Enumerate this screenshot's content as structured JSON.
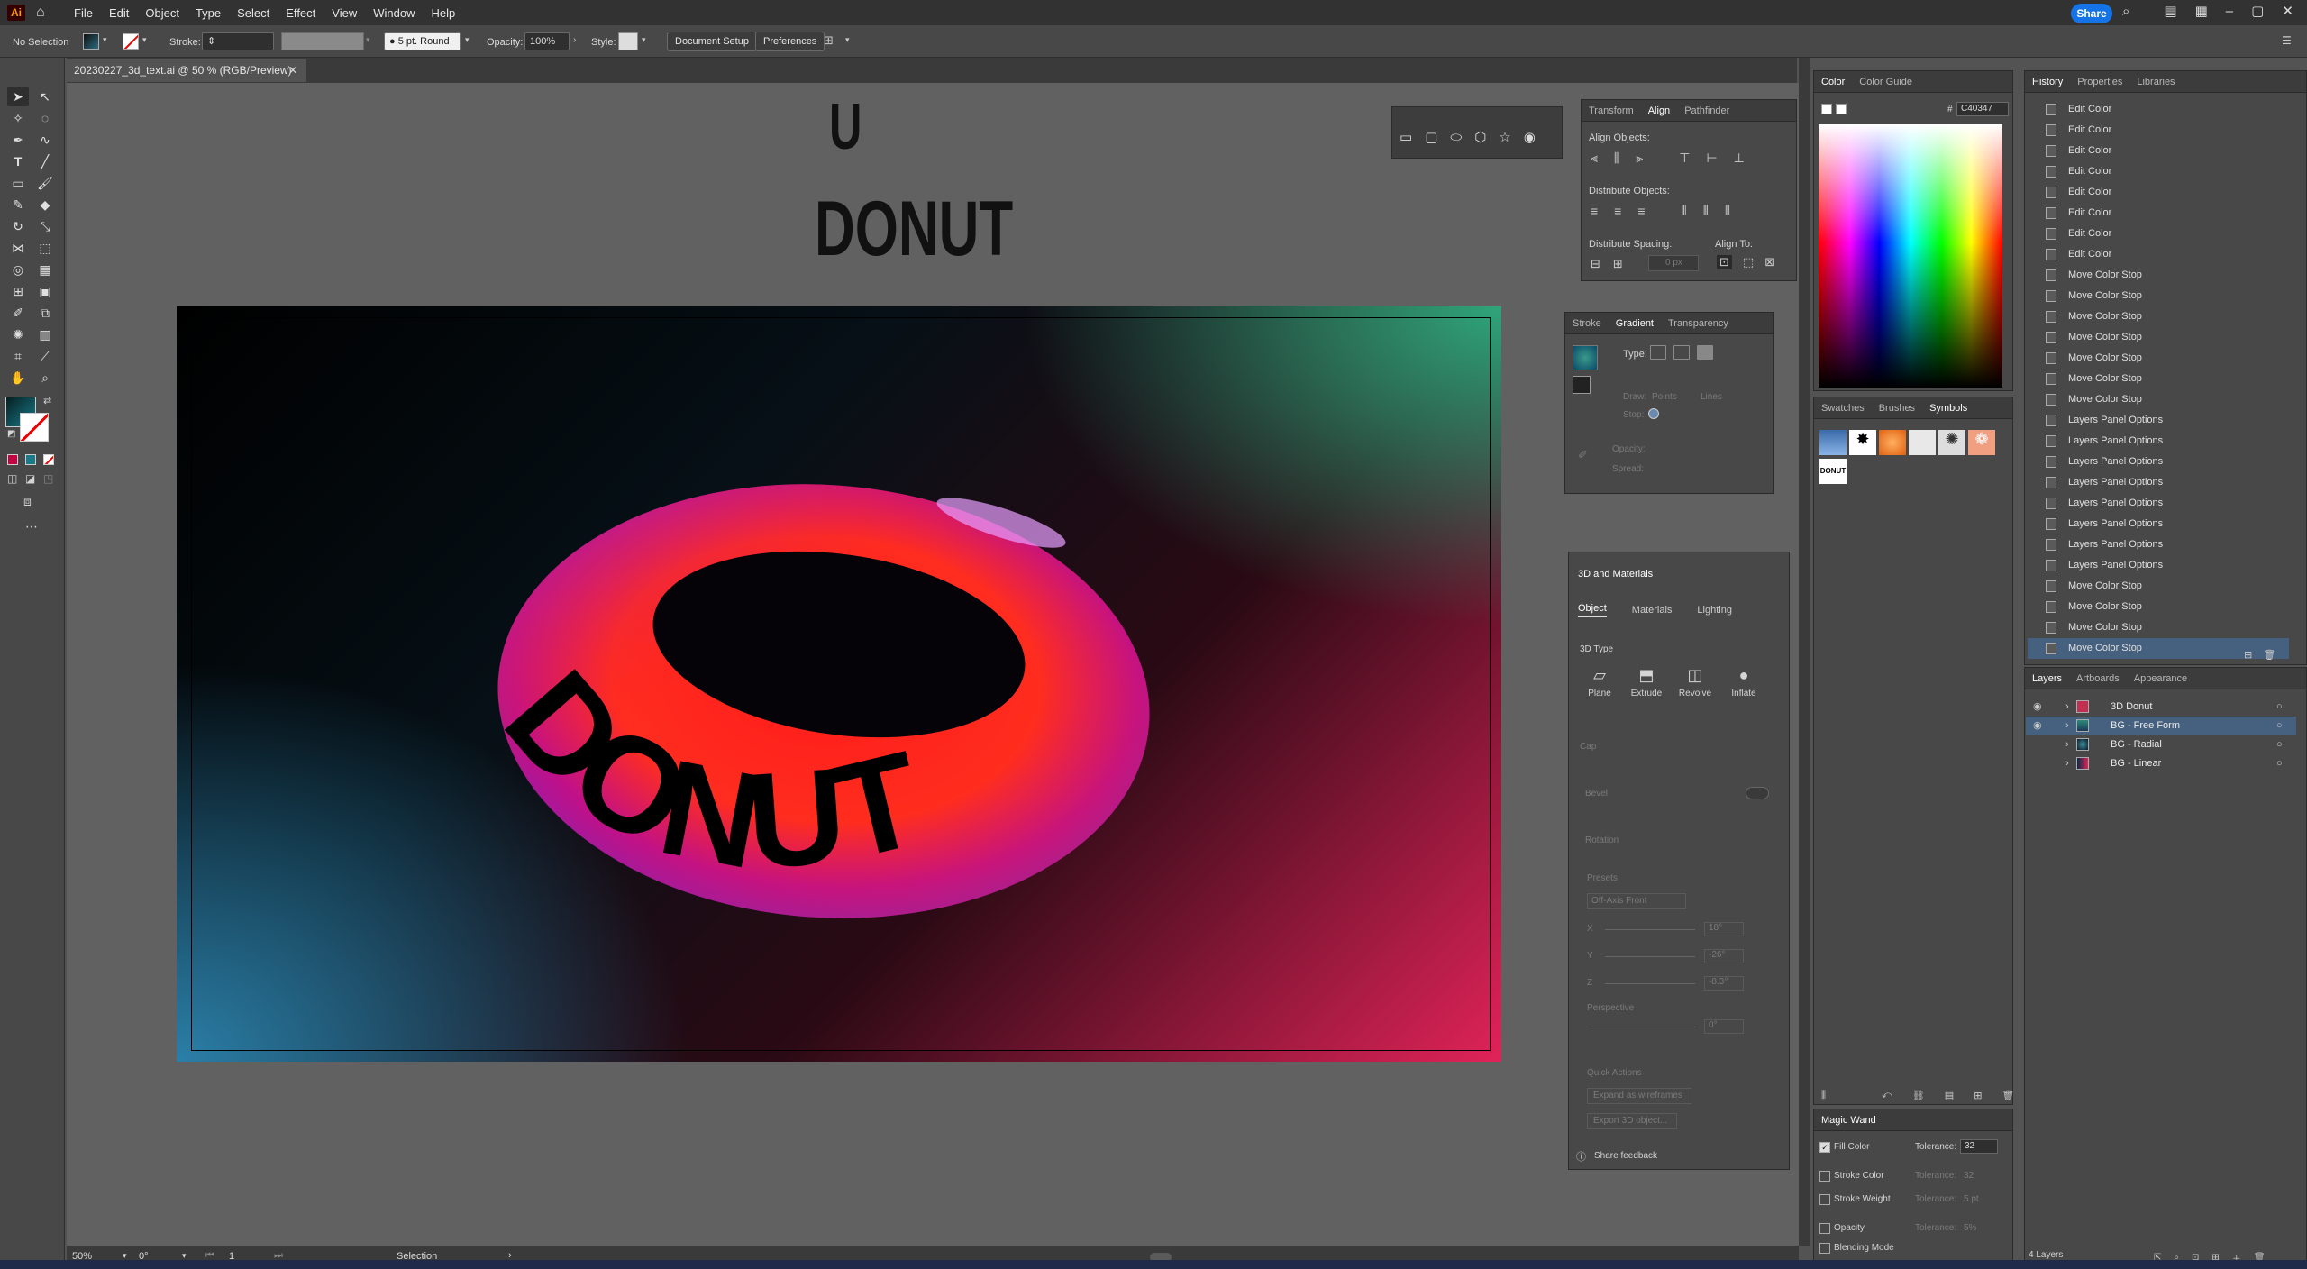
{
  "app": {
    "logo": "Ai",
    "share_label": "Share"
  },
  "menu": [
    "File",
    "Edit",
    "Object",
    "Type",
    "Select",
    "Effect",
    "View",
    "Window",
    "Help"
  ],
  "control": {
    "selection_status": "No Selection",
    "stroke_label": "Stroke:",
    "brush_label": "5 pt. Round",
    "opacity_label": "Opacity:",
    "opacity_value": "100%",
    "style_label": "Style:",
    "document_setup": "Document Setup",
    "preferences": "Preferences"
  },
  "document": {
    "tab_title": "20230227_3d_text.ai @ 50 % (RGB/Preview)"
  },
  "canvas": {
    "title_top": "U",
    "title_main": "DONUT",
    "donut_text": "DONUT"
  },
  "align_panel": {
    "tabs": [
      "Transform",
      "Align",
      "Pathfinder"
    ],
    "align_objects": "Align Objects:",
    "distribute_objects": "Distribute Objects:",
    "distribute_spacing": "Distribute Spacing:",
    "align_to": "Align To:",
    "spacing_value": "0 px"
  },
  "gradient_panel": {
    "tabs": [
      "Stroke",
      "Gradient",
      "Transparency"
    ],
    "type_label": "Type:",
    "draw_label": "Draw:",
    "draw_points": "Points",
    "draw_lines": "Lines",
    "stop_label": "Stop:",
    "opacity_label": "Opacity:",
    "spread_label": "Spread:"
  },
  "materials_panel": {
    "title": "3D and Materials",
    "tabs": [
      "Object",
      "Materials",
      "Lighting"
    ],
    "type_header": "3D Type",
    "types": [
      "Plane",
      "Extrude",
      "Revolve",
      "Inflate"
    ],
    "cap": "Cap",
    "bevel": "Bevel",
    "rotation": "Rotation",
    "presets": "Presets",
    "preset_value": "Off-Axis Front",
    "x_label": "X",
    "x_value": "18°",
    "y_label": "Y",
    "y_value": "-26°",
    "z_label": "Z",
    "z_value": "-8.3°",
    "perspective": "Perspective",
    "perspective_value": "0°",
    "quick_actions": "Quick Actions",
    "expand_wireframes": "Expand as wireframes",
    "export_3d": "Export 3D object...",
    "share_feedback": "Share feedback"
  },
  "color_panel": {
    "tabs": [
      "Color",
      "Color Guide"
    ],
    "hex_label": "#",
    "hex_value": "C40347"
  },
  "swatches_panel": {
    "tabs": [
      "Swatches",
      "Brushes",
      "Symbols"
    ],
    "donut_symbol_label": "DONUT"
  },
  "magic_wand": {
    "title": "Magic Wand",
    "rows": [
      {
        "label": "Fill Color",
        "checked": true,
        "tol_label": "Tolerance:",
        "tol": "32"
      },
      {
        "label": "Stroke Color",
        "checked": false,
        "tol_label": "Tolerance:",
        "tol": "32"
      },
      {
        "label": "Stroke Weight",
        "checked": false,
        "tol_label": "Tolerance:",
        "tol": "5 pt"
      },
      {
        "label": "Opacity",
        "checked": false,
        "tol_label": "Tolerance:",
        "tol": "5%"
      },
      {
        "label": "Blending Mode",
        "checked": false,
        "tol_label": "",
        "tol": ""
      }
    ]
  },
  "history_panel": {
    "tabs": [
      "History",
      "Properties",
      "Libraries"
    ],
    "items": [
      "Edit Color",
      "Edit Color",
      "Edit Color",
      "Edit Color",
      "Edit Color",
      "Edit Color",
      "Edit Color",
      "Edit Color",
      "Move Color Stop",
      "Move Color Stop",
      "Move Color Stop",
      "Move Color Stop",
      "Move Color Stop",
      "Move Color Stop",
      "Move Color Stop",
      "Layers Panel Options",
      "Layers Panel Options",
      "Layers Panel Options",
      "Layers Panel Options",
      "Layers Panel Options",
      "Layers Panel Options",
      "Layers Panel Options",
      "Layers Panel Options",
      "Move Color Stop",
      "Move Color Stop",
      "Move Color Stop",
      "Move Color Stop"
    ]
  },
  "layers_panel": {
    "tabs": [
      "Layers",
      "Artboards",
      "Appearance"
    ],
    "layers": [
      "3D Donut",
      "BG - Free Form",
      "BG - Radial",
      "BG - Linear"
    ],
    "count": "4 Layers"
  },
  "status": {
    "zoom": "50%",
    "rotation": "0°",
    "artboard": "1",
    "tool": "Selection"
  },
  "colors": {
    "accent": "#1473e6",
    "selection": "#46607f",
    "artboard_pink": "#e02358",
    "artboard_green": "#2fa57a",
    "artboard_blue": "#2b7fa8"
  }
}
